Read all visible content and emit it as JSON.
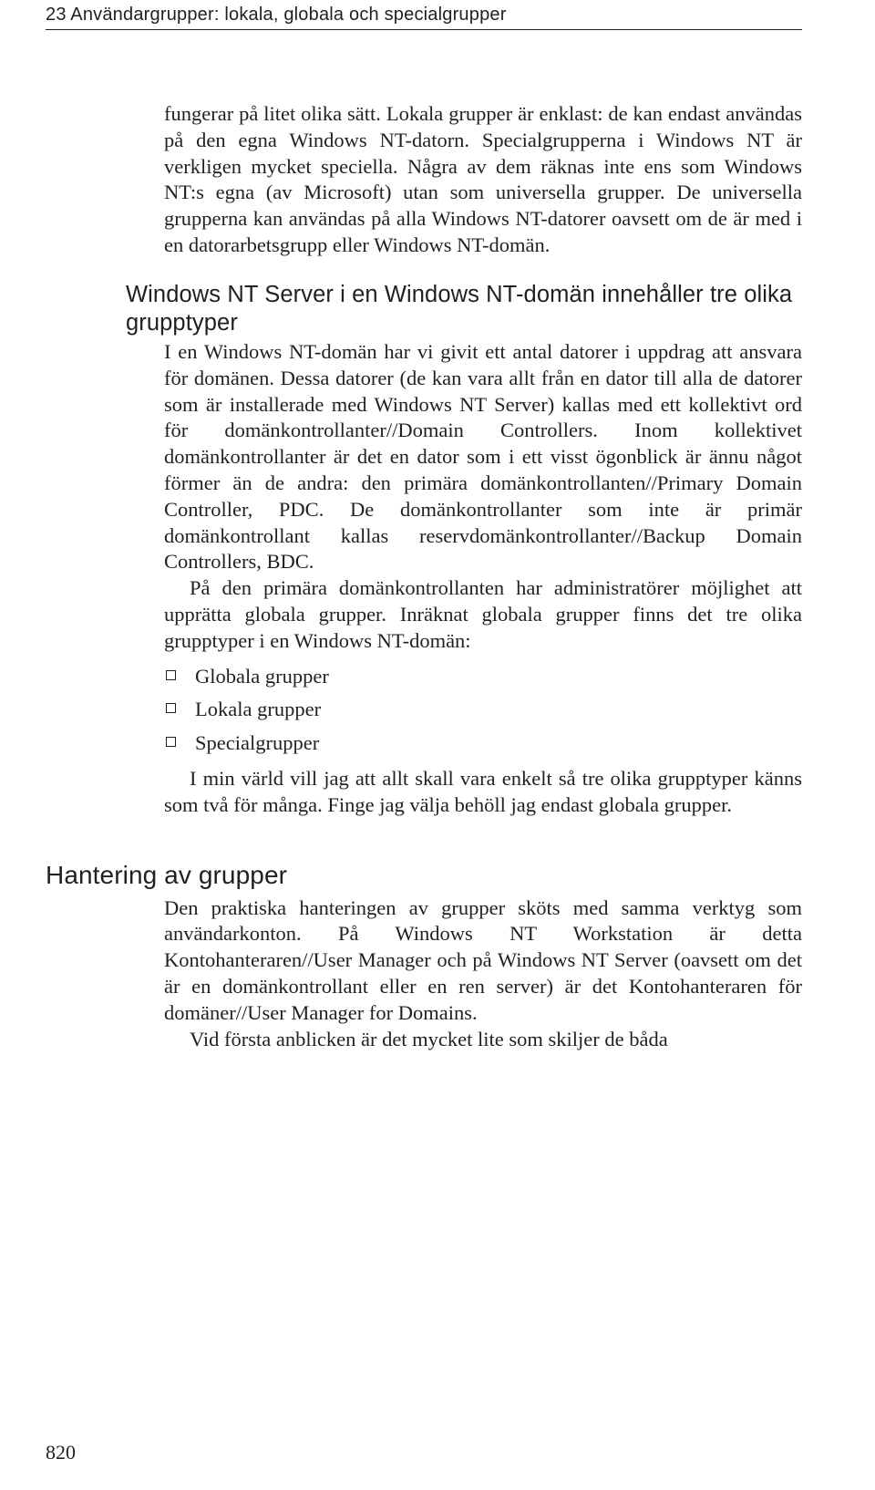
{
  "running_head": "23  Användargrupper: lokala, globala och specialgrupper",
  "intro_paragraph": "fungerar på litet olika sätt. Lokala grupper är enklast: de kan endast användas på den egna Windows NT-datorn. Specialgrupperna i Windows NT är verkligen mycket speci­ella. Några av dem räknas inte ens som Windows NT:s egna (av Microsoft) utan som universella grupper. De universella grupperna kan användas på alla Windows NT-datorer oavsett om de är med i en datorarbetsgrupp eller Windows NT-domän.",
  "section1": {
    "title": "Windows NT Server i en Windows NT-domän innehåller tre olika grupptyper",
    "para1": "I en Windows NT-domän har vi givit ett antal datorer i uppdrag att ansvara för domänen. Dessa datorer (de kan vara allt från en dator till alla de datorer som är installerade med Windows NT Server) kallas med ett kollektivt ord för domänkontrollanter//Domain Controllers. Inom kollektivet domänkontrollanter är det en dator som i ett visst ögonblick är ännu något förmer än de andra: den primära domänkontrollanten//Primary Domain Controller, PDC. De domänkontrollanter som inte är primär domänkontrollant kallas reservdomänkontrollanter//Backup Domain Controllers, BDC.",
    "para2": "På den primära domänkontrollanten har administratörer möjlighet att upprätta globala grupper. Inräknat globala grupper finns det tre olika grupptyper i en Windows NT-domän:",
    "bullets": [
      "Globala grupper",
      "Lokala grupper",
      "Specialgrupper"
    ],
    "para3": "I min värld vill jag att allt skall vara enkelt så tre olika grupptyper känns som två för många. Finge jag välja behöll jag endast globala grupper."
  },
  "section2": {
    "title": "Hantering av grupper",
    "para1": "Den praktiska hanteringen av grupper sköts med samma verktyg som användarkonton. På Windows NT Workstation är detta Kontohanteraren//User Manager och på Windows NT Server (oavsett om det är en domänkontrollant eller en ren server) är det Kontohanteraren för domäner//User Manager for Domains.",
    "para2": "Vid första anblicken är det mycket lite som skiljer de båda"
  },
  "page_number": "820"
}
